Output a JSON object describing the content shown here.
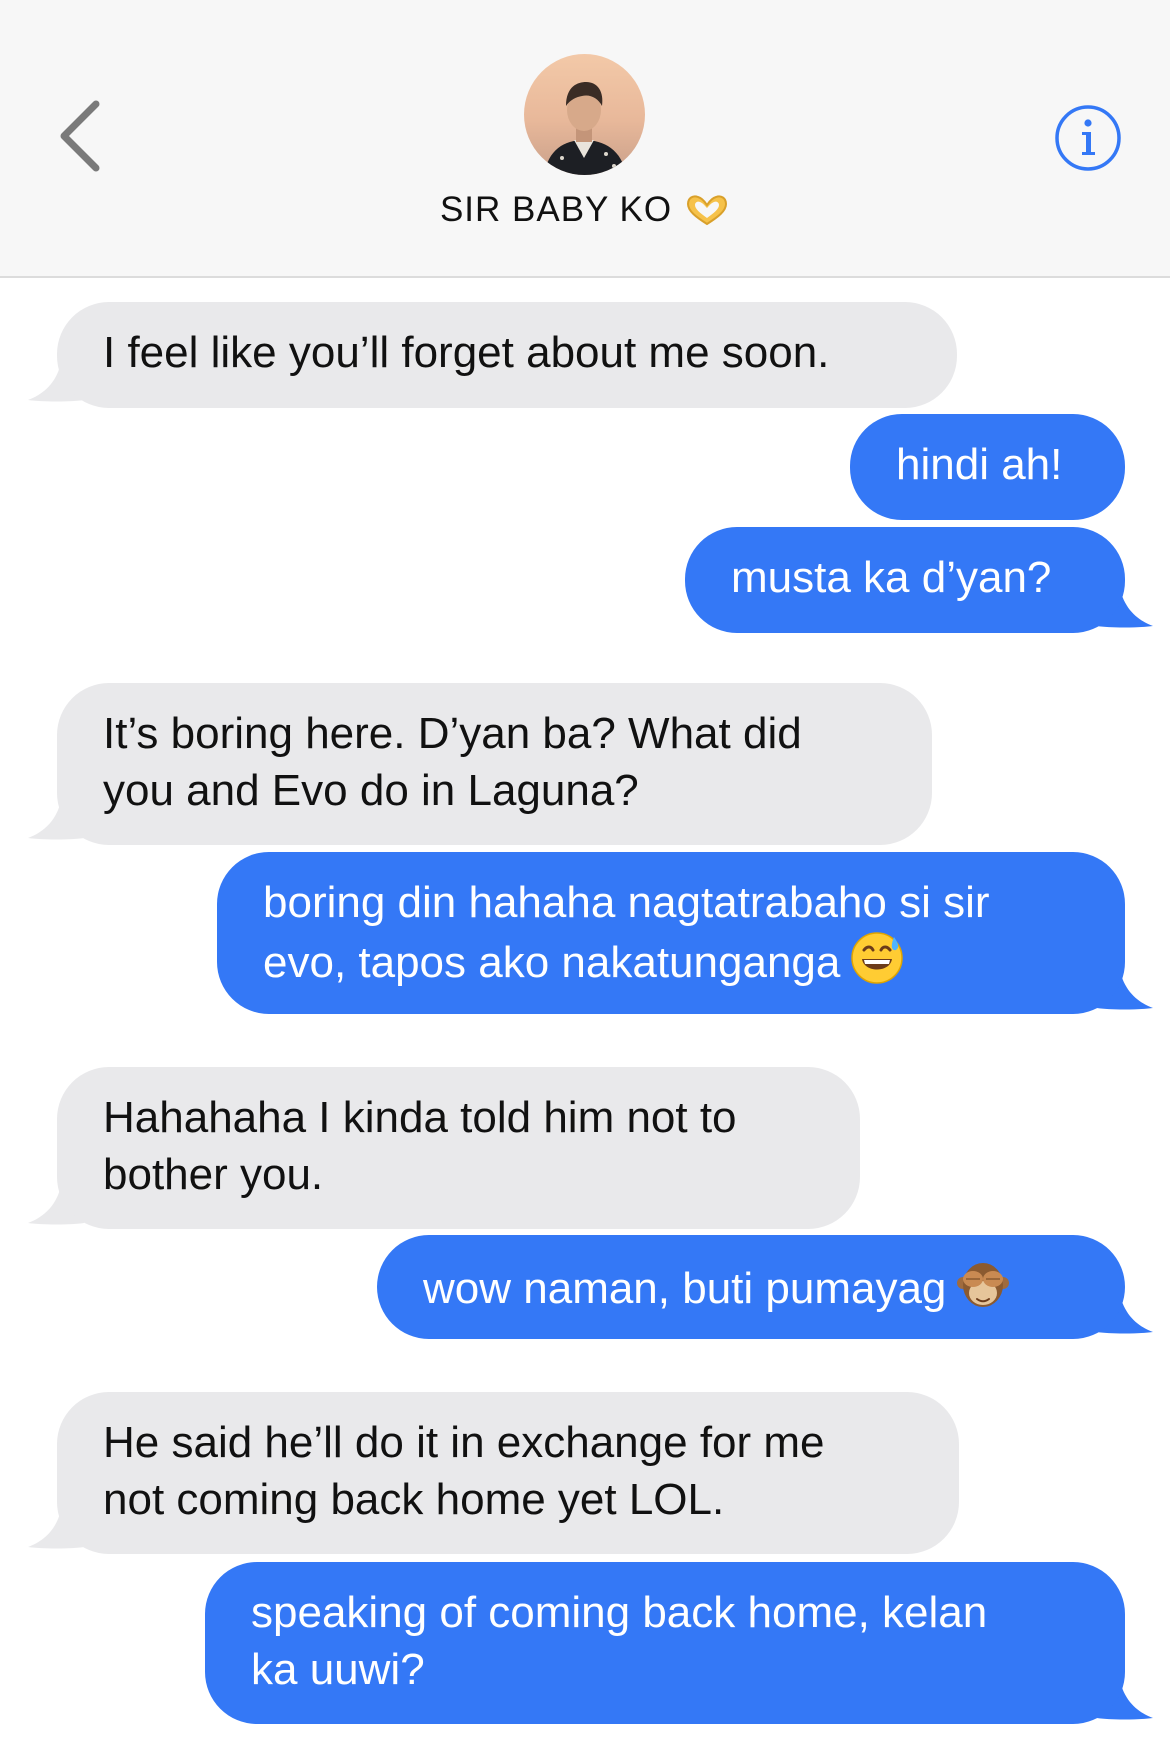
{
  "header": {
    "contact_name": "SIR BABY KO"
  },
  "messages": [
    {
      "direction": "incoming",
      "line1": "I feel like you’ll forget about me soon."
    },
    {
      "direction": "outgoing",
      "line1": "hindi ah!"
    },
    {
      "direction": "outgoing",
      "line1": "musta ka d’yan?"
    },
    {
      "direction": "incoming",
      "line1": "It’s boring here. D’yan ba? What did",
      "line2": "you and Evo do in Laguna?"
    },
    {
      "direction": "outgoing",
      "line1": "boring din hahaha nagtatrabaho si sir",
      "line2": "evo, tapos ako nakatunganga",
      "emoji": "grinning-sweat-emoji"
    },
    {
      "direction": "incoming",
      "line1": "Hahahaha I kinda told him not to",
      "line2": "bother you."
    },
    {
      "direction": "outgoing",
      "line1": "wow naman, buti pumayag",
      "emoji": "see-no-evil-monkey-emoji"
    },
    {
      "direction": "incoming",
      "line1": "He said he’ll do it in exchange for me",
      "line2": "not coming back home yet LOL."
    },
    {
      "direction": "outgoing",
      "line1": "speaking of coming back home, kelan",
      "line2": "ka uuwi?"
    }
  ],
  "colors": {
    "outgoing_bubble": "#3478f6",
    "incoming_bubble": "#e9e9eb",
    "accent": "#3478f6"
  }
}
